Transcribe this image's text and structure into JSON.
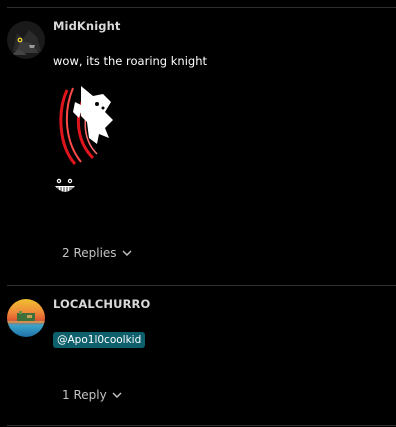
{
  "comments": [
    {
      "author": "MidKnight",
      "text": "wow, its the roaring knight",
      "attachment_icon": "roaring-knight-sprite",
      "emoji_icon": "grinning-face-emoji",
      "replies_label": "2 Replies"
    },
    {
      "author": "LOCALCHURRO",
      "mention": "@Apo1l0coolkid",
      "replies_label": "1 Reply"
    }
  ],
  "colors": {
    "background": "#000000",
    "divider": "#2e2e2e",
    "mention_bg": "#0d5f6b",
    "muted_text": "#c4c4c4"
  }
}
